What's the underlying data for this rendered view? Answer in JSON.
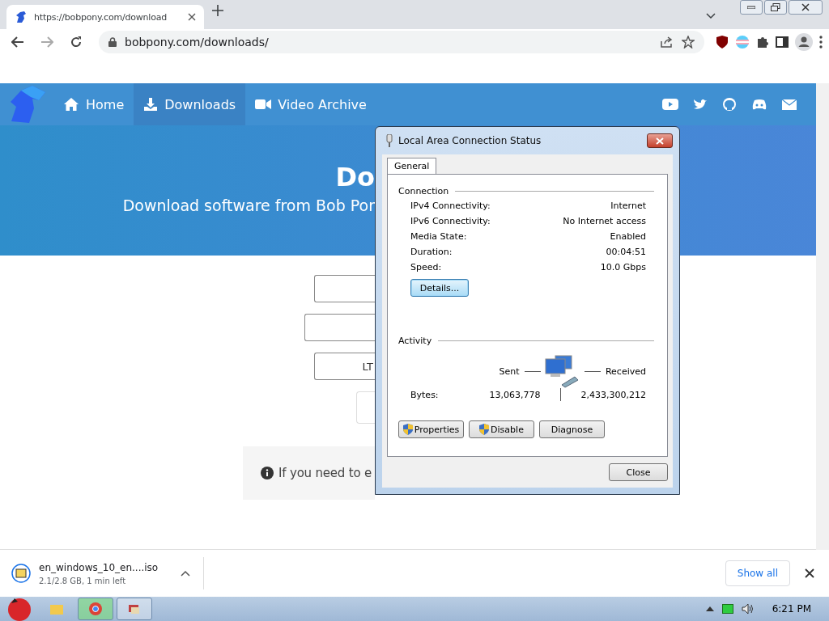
{
  "browser": {
    "tabs": [
      {
        "title": "https://bobpony.com/download",
        "selected": true
      }
    ],
    "address": "bobpony.com/downloads/"
  },
  "site": {
    "nav": [
      {
        "label": "Home",
        "selected": false
      },
      {
        "label": "Downloads",
        "selected": true
      },
      {
        "label": "Video Archive",
        "selected": false
      }
    ],
    "hero": {
      "title": "Do",
      "subtitle": "Download software from Bob Por"
    },
    "form": {
      "field_3": "LT"
    },
    "notice": "If you need to e"
  },
  "dialog": {
    "title": "Local Area Connection Status",
    "tabs": [
      {
        "label": "General",
        "selected": true
      }
    ],
    "connection": {
      "heading": "Connection",
      "rows": [
        {
          "label": "IPv4 Connectivity:",
          "value": "Internet"
        },
        {
          "label": "IPv6 Connectivity:",
          "value": "No Internet access"
        },
        {
          "label": "Media State:",
          "value": "Enabled"
        },
        {
          "label": "Duration:",
          "value": "00:04:51"
        },
        {
          "label": "Speed:",
          "value": "10.0 Gbps"
        }
      ],
      "details_button": "Details..."
    },
    "activity": {
      "heading": "Activity",
      "sent_label": "Sent",
      "received_label": "Received",
      "bytes_label": "Bytes:",
      "sent": "13,063,778",
      "received": "2,433,300,212"
    },
    "buttons": [
      {
        "label": "Properties",
        "shield": true
      },
      {
        "label": "Disable",
        "shield": true
      },
      {
        "label": "Diagnose",
        "shield": false
      }
    ],
    "close_button": "Close"
  },
  "downloads_bar": {
    "file": "en_windows_10_en....iso",
    "status": "2.1/2.8 GB, 1 min left",
    "show_all": "Show all"
  },
  "taskbar": {
    "time": "6:21 PM"
  }
}
